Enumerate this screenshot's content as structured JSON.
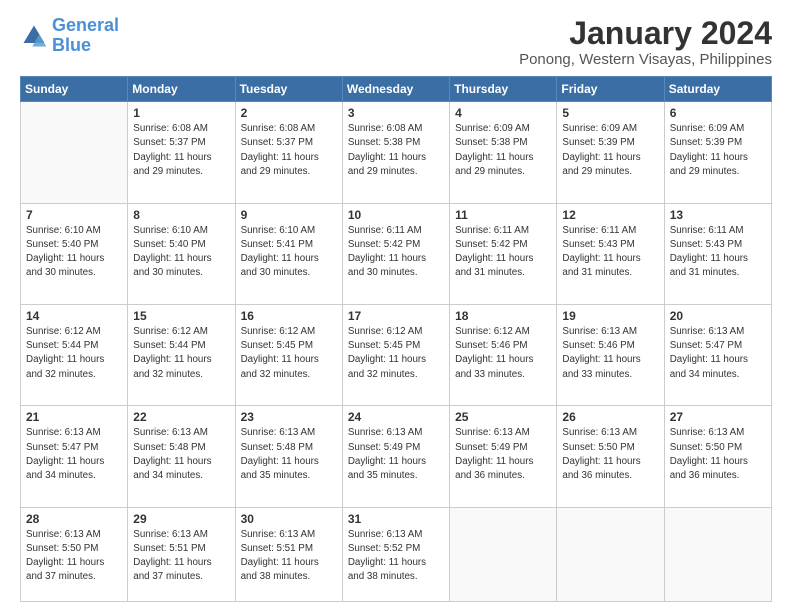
{
  "logo": {
    "line1": "General",
    "line2": "Blue"
  },
  "title": "January 2024",
  "subtitle": "Ponong, Western Visayas, Philippines",
  "weekdays": [
    "Sunday",
    "Monday",
    "Tuesday",
    "Wednesday",
    "Thursday",
    "Friday",
    "Saturday"
  ],
  "weeks": [
    [
      {
        "day": "",
        "sunrise": "",
        "sunset": "",
        "daylight": ""
      },
      {
        "day": "1",
        "sunrise": "Sunrise: 6:08 AM",
        "sunset": "Sunset: 5:37 PM",
        "daylight": "Daylight: 11 hours and 29 minutes."
      },
      {
        "day": "2",
        "sunrise": "Sunrise: 6:08 AM",
        "sunset": "Sunset: 5:37 PM",
        "daylight": "Daylight: 11 hours and 29 minutes."
      },
      {
        "day": "3",
        "sunrise": "Sunrise: 6:08 AM",
        "sunset": "Sunset: 5:38 PM",
        "daylight": "Daylight: 11 hours and 29 minutes."
      },
      {
        "day": "4",
        "sunrise": "Sunrise: 6:09 AM",
        "sunset": "Sunset: 5:38 PM",
        "daylight": "Daylight: 11 hours and 29 minutes."
      },
      {
        "day": "5",
        "sunrise": "Sunrise: 6:09 AM",
        "sunset": "Sunset: 5:39 PM",
        "daylight": "Daylight: 11 hours and 29 minutes."
      },
      {
        "day": "6",
        "sunrise": "Sunrise: 6:09 AM",
        "sunset": "Sunset: 5:39 PM",
        "daylight": "Daylight: 11 hours and 29 minutes."
      }
    ],
    [
      {
        "day": "7",
        "sunrise": "Sunrise: 6:10 AM",
        "sunset": "Sunset: 5:40 PM",
        "daylight": "Daylight: 11 hours and 30 minutes."
      },
      {
        "day": "8",
        "sunrise": "Sunrise: 6:10 AM",
        "sunset": "Sunset: 5:40 PM",
        "daylight": "Daylight: 11 hours and 30 minutes."
      },
      {
        "day": "9",
        "sunrise": "Sunrise: 6:10 AM",
        "sunset": "Sunset: 5:41 PM",
        "daylight": "Daylight: 11 hours and 30 minutes."
      },
      {
        "day": "10",
        "sunrise": "Sunrise: 6:11 AM",
        "sunset": "Sunset: 5:42 PM",
        "daylight": "Daylight: 11 hours and 30 minutes."
      },
      {
        "day": "11",
        "sunrise": "Sunrise: 6:11 AM",
        "sunset": "Sunset: 5:42 PM",
        "daylight": "Daylight: 11 hours and 31 minutes."
      },
      {
        "day": "12",
        "sunrise": "Sunrise: 6:11 AM",
        "sunset": "Sunset: 5:43 PM",
        "daylight": "Daylight: 11 hours and 31 minutes."
      },
      {
        "day": "13",
        "sunrise": "Sunrise: 6:11 AM",
        "sunset": "Sunset: 5:43 PM",
        "daylight": "Daylight: 11 hours and 31 minutes."
      }
    ],
    [
      {
        "day": "14",
        "sunrise": "Sunrise: 6:12 AM",
        "sunset": "Sunset: 5:44 PM",
        "daylight": "Daylight: 11 hours and 32 minutes."
      },
      {
        "day": "15",
        "sunrise": "Sunrise: 6:12 AM",
        "sunset": "Sunset: 5:44 PM",
        "daylight": "Daylight: 11 hours and 32 minutes."
      },
      {
        "day": "16",
        "sunrise": "Sunrise: 6:12 AM",
        "sunset": "Sunset: 5:45 PM",
        "daylight": "Daylight: 11 hours and 32 minutes."
      },
      {
        "day": "17",
        "sunrise": "Sunrise: 6:12 AM",
        "sunset": "Sunset: 5:45 PM",
        "daylight": "Daylight: 11 hours and 32 minutes."
      },
      {
        "day": "18",
        "sunrise": "Sunrise: 6:12 AM",
        "sunset": "Sunset: 5:46 PM",
        "daylight": "Daylight: 11 hours and 33 minutes."
      },
      {
        "day": "19",
        "sunrise": "Sunrise: 6:13 AM",
        "sunset": "Sunset: 5:46 PM",
        "daylight": "Daylight: 11 hours and 33 minutes."
      },
      {
        "day": "20",
        "sunrise": "Sunrise: 6:13 AM",
        "sunset": "Sunset: 5:47 PM",
        "daylight": "Daylight: 11 hours and 34 minutes."
      }
    ],
    [
      {
        "day": "21",
        "sunrise": "Sunrise: 6:13 AM",
        "sunset": "Sunset: 5:47 PM",
        "daylight": "Daylight: 11 hours and 34 minutes."
      },
      {
        "day": "22",
        "sunrise": "Sunrise: 6:13 AM",
        "sunset": "Sunset: 5:48 PM",
        "daylight": "Daylight: 11 hours and 34 minutes."
      },
      {
        "day": "23",
        "sunrise": "Sunrise: 6:13 AM",
        "sunset": "Sunset: 5:48 PM",
        "daylight": "Daylight: 11 hours and 35 minutes."
      },
      {
        "day": "24",
        "sunrise": "Sunrise: 6:13 AM",
        "sunset": "Sunset: 5:49 PM",
        "daylight": "Daylight: 11 hours and 35 minutes."
      },
      {
        "day": "25",
        "sunrise": "Sunrise: 6:13 AM",
        "sunset": "Sunset: 5:49 PM",
        "daylight": "Daylight: 11 hours and 36 minutes."
      },
      {
        "day": "26",
        "sunrise": "Sunrise: 6:13 AM",
        "sunset": "Sunset: 5:50 PM",
        "daylight": "Daylight: 11 hours and 36 minutes."
      },
      {
        "day": "27",
        "sunrise": "Sunrise: 6:13 AM",
        "sunset": "Sunset: 5:50 PM",
        "daylight": "Daylight: 11 hours and 36 minutes."
      }
    ],
    [
      {
        "day": "28",
        "sunrise": "Sunrise: 6:13 AM",
        "sunset": "Sunset: 5:50 PM",
        "daylight": "Daylight: 11 hours and 37 minutes."
      },
      {
        "day": "29",
        "sunrise": "Sunrise: 6:13 AM",
        "sunset": "Sunset: 5:51 PM",
        "daylight": "Daylight: 11 hours and 37 minutes."
      },
      {
        "day": "30",
        "sunrise": "Sunrise: 6:13 AM",
        "sunset": "Sunset: 5:51 PM",
        "daylight": "Daylight: 11 hours and 38 minutes."
      },
      {
        "day": "31",
        "sunrise": "Sunrise: 6:13 AM",
        "sunset": "Sunset: 5:52 PM",
        "daylight": "Daylight: 11 hours and 38 minutes."
      },
      {
        "day": "",
        "sunrise": "",
        "sunset": "",
        "daylight": ""
      },
      {
        "day": "",
        "sunrise": "",
        "sunset": "",
        "daylight": ""
      },
      {
        "day": "",
        "sunrise": "",
        "sunset": "",
        "daylight": ""
      }
    ]
  ]
}
